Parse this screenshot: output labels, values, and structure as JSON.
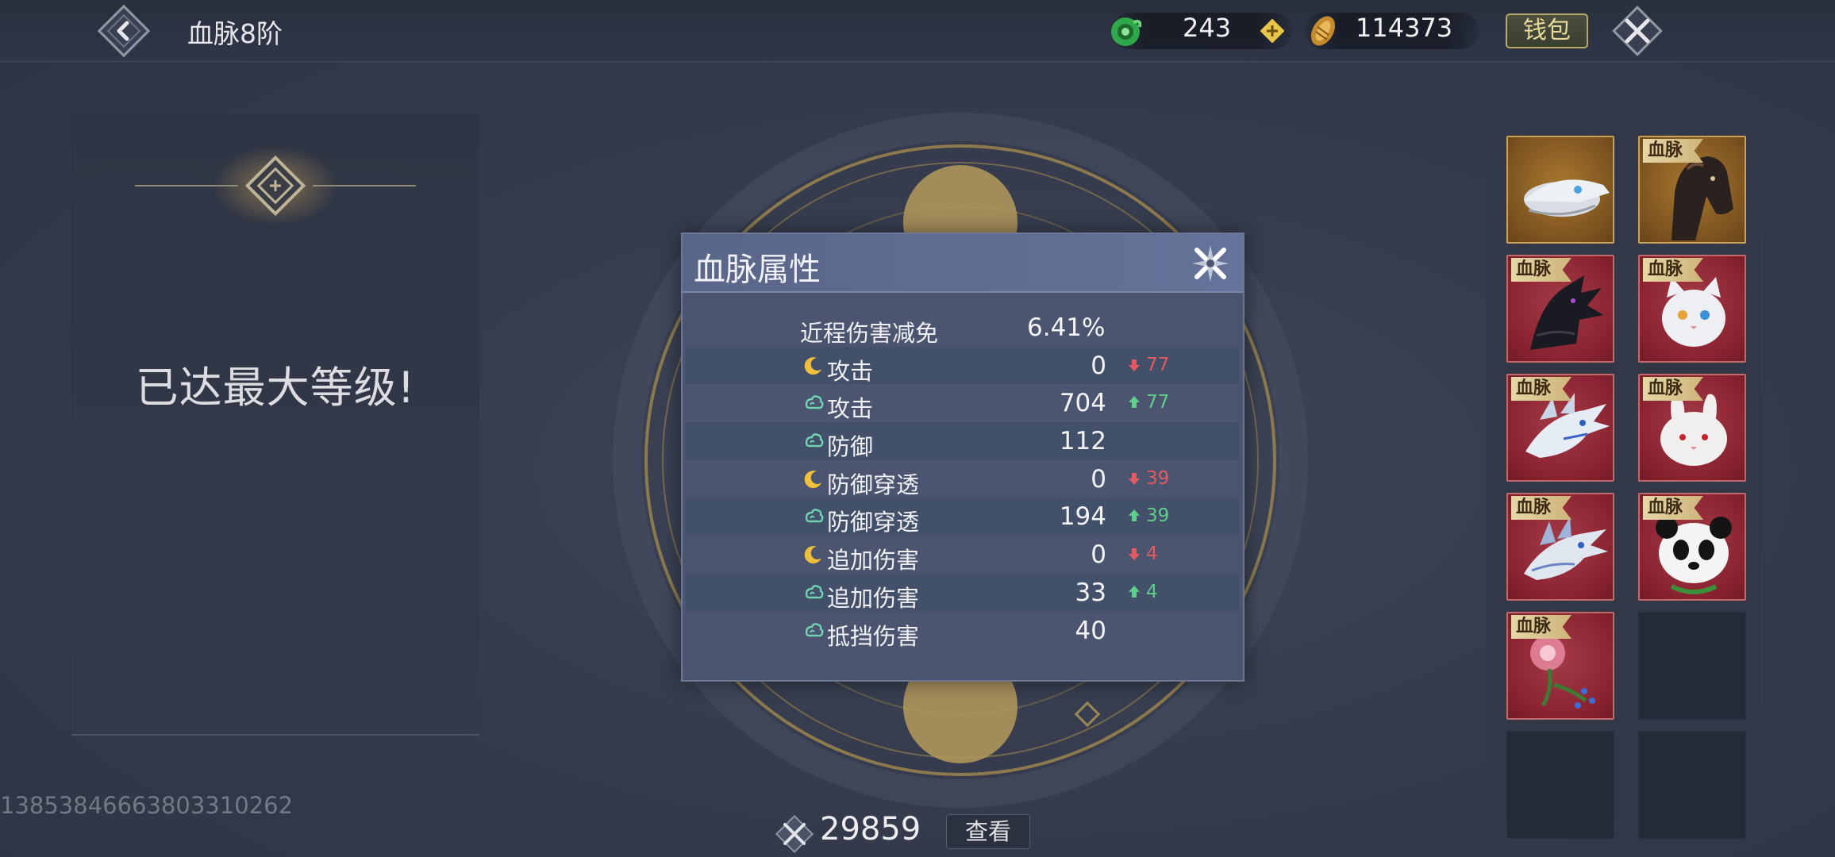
{
  "header": {
    "title": "血脉8阶",
    "currency_jade": "243",
    "currency_gold": "114373",
    "wallet_label": "钱包"
  },
  "left_panel": {
    "max_level_text": "已达最大等级!"
  },
  "bottom": {
    "power": "29859",
    "view_label": "查看",
    "uid": "13853846663803310262"
  },
  "slots": [
    {
      "tag": "",
      "creature": "bird-skull",
      "bg": "gold"
    },
    {
      "tag": "血脉",
      "creature": "dark-horse",
      "bg": "gold"
    },
    {
      "tag": "血脉",
      "creature": "black-dragon",
      "bg": "red"
    },
    {
      "tag": "血脉",
      "creature": "white-cat",
      "bg": "red"
    },
    {
      "tag": "血脉",
      "creature": "white-dragon",
      "bg": "red"
    },
    {
      "tag": "血脉",
      "creature": "white-rabbit",
      "bg": "red"
    },
    {
      "tag": "血脉",
      "creature": "ice-dragon",
      "bg": "red"
    },
    {
      "tag": "血脉",
      "creature": "panda",
      "bg": "red"
    },
    {
      "tag": "血脉",
      "creature": "flower-vine",
      "bg": "red"
    },
    {
      "tag": "",
      "creature": "",
      "bg": "empty"
    },
    {
      "tag": "",
      "creature": "",
      "bg": "empty"
    },
    {
      "tag": "",
      "creature": "",
      "bg": "empty"
    }
  ],
  "modal": {
    "title": "血脉属性",
    "rows": [
      {
        "icon": "",
        "label": "近程伤害减免",
        "value": "6.41%",
        "diff_dir": "",
        "diff": ""
      },
      {
        "icon": "moon-icon",
        "label": "攻击",
        "value": "0",
        "diff_dir": "down",
        "diff": "77"
      },
      {
        "icon": "cloud-icon",
        "label": "攻击",
        "value": "704",
        "diff_dir": "up",
        "diff": "77"
      },
      {
        "icon": "cloud-icon",
        "label": "防御",
        "value": "112",
        "diff_dir": "",
        "diff": ""
      },
      {
        "icon": "moon-icon",
        "label": "防御穿透",
        "value": "0",
        "diff_dir": "down",
        "diff": "39"
      },
      {
        "icon": "cloud-icon",
        "label": "防御穿透",
        "value": "194",
        "diff_dir": "up",
        "diff": "39"
      },
      {
        "icon": "moon-icon",
        "label": "追加伤害",
        "value": "0",
        "diff_dir": "down",
        "diff": "4"
      },
      {
        "icon": "cloud-icon",
        "label": "追加伤害",
        "value": "33",
        "diff_dir": "up",
        "diff": "4"
      },
      {
        "icon": "cloud-icon",
        "label": "抵挡伤害",
        "value": "40",
        "diff_dir": "",
        "diff": ""
      }
    ]
  },
  "colors": {
    "accent_gold": "#c9a25a",
    "down_red": "#e35b60",
    "up_green": "#5fcf8a",
    "moon_yellow": "#f0c03a",
    "cloud_teal": "#6fd3b4"
  }
}
